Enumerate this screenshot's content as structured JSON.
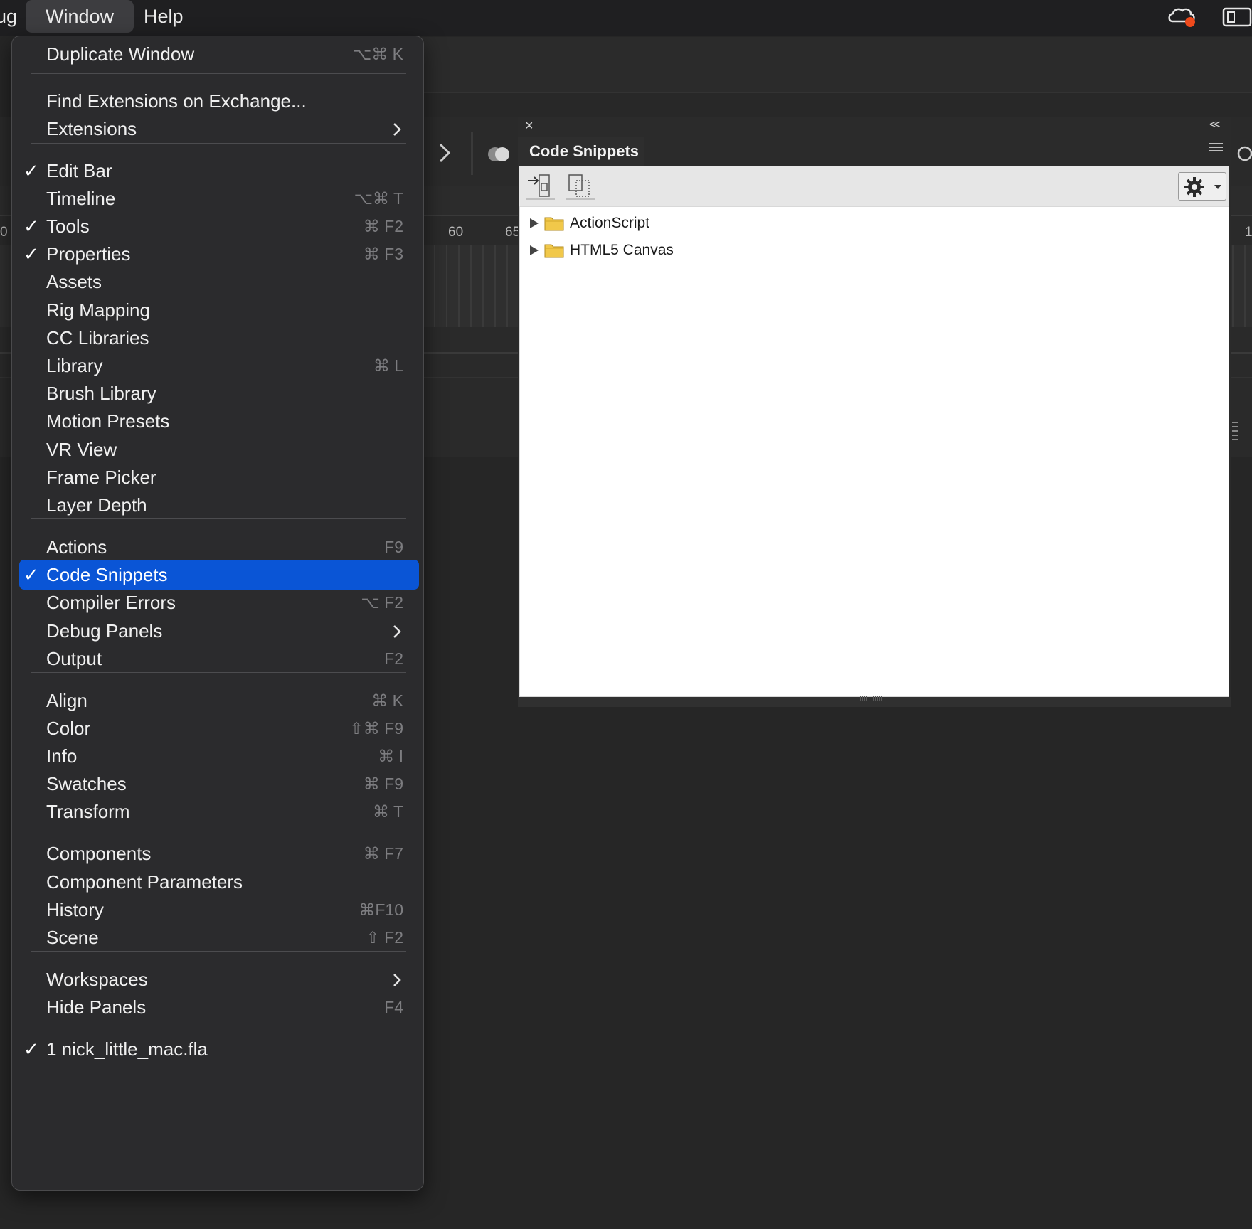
{
  "menubar": {
    "partial_item": "ug",
    "window_label": "Window",
    "help_label": "Help",
    "icons": [
      "creative-cloud-icon",
      "display-mirroring-icon"
    ]
  },
  "timeline": {
    "ticks": [
      "0",
      "60",
      "65",
      "1"
    ]
  },
  "panel": {
    "title": "Code Snippets",
    "close_glyph": "×",
    "collapse_glyph": "<<",
    "toolbar": {
      "icons": [
        "add-to-current-frame-icon",
        "copy-to-clipboard-icon",
        "gear-icon"
      ]
    },
    "tree": [
      {
        "label": "ActionScript",
        "icon": "folder-icon"
      },
      {
        "label": "HTML5 Canvas",
        "icon": "folder-icon"
      }
    ]
  },
  "menu": {
    "items": [
      {
        "label": "Duplicate Window",
        "shortcut": "⌥⌘ K",
        "checked": false
      },
      {
        "label": "Find Extensions on Exchange...",
        "shortcut": "",
        "checked": false
      },
      {
        "label": "Extensions",
        "shortcut": "",
        "checked": false,
        "submenu": true
      },
      {
        "label": "Edit Bar",
        "shortcut": "",
        "checked": true
      },
      {
        "label": "Timeline",
        "shortcut": "⌥⌘ T",
        "checked": false
      },
      {
        "label": "Tools",
        "shortcut": "⌘ F2",
        "checked": true
      },
      {
        "label": "Properties",
        "shortcut": "⌘ F3",
        "checked": true
      },
      {
        "label": "Assets",
        "shortcut": "",
        "checked": false
      },
      {
        "label": "Rig Mapping",
        "shortcut": "",
        "checked": false
      },
      {
        "label": "CC Libraries",
        "shortcut": "",
        "checked": false
      },
      {
        "label": "Library",
        "shortcut": "⌘ L",
        "checked": false
      },
      {
        "label": "Brush Library",
        "shortcut": "",
        "checked": false
      },
      {
        "label": "Motion Presets",
        "shortcut": "",
        "checked": false
      },
      {
        "label": "VR View",
        "shortcut": "",
        "checked": false
      },
      {
        "label": "Frame Picker",
        "shortcut": "",
        "checked": false
      },
      {
        "label": "Layer Depth",
        "shortcut": "",
        "checked": false
      },
      {
        "label": "Actions",
        "shortcut": "F9",
        "checked": false
      },
      {
        "label": "Code Snippets",
        "shortcut": "",
        "checked": true,
        "highlighted": true
      },
      {
        "label": "Compiler Errors",
        "shortcut": "⌥ F2",
        "checked": false
      },
      {
        "label": "Debug Panels",
        "shortcut": "",
        "checked": false,
        "submenu": true
      },
      {
        "label": "Output",
        "shortcut": "F2",
        "checked": false
      },
      {
        "label": "Align",
        "shortcut": "⌘ K",
        "checked": false
      },
      {
        "label": "Color",
        "shortcut": "⇧⌘ F9",
        "checked": false
      },
      {
        "label": "Info",
        "shortcut": "⌘ I",
        "checked": false
      },
      {
        "label": "Swatches",
        "shortcut": "⌘ F9",
        "checked": false
      },
      {
        "label": "Transform",
        "shortcut": "⌘ T",
        "checked": false
      },
      {
        "label": "Components",
        "shortcut": "⌘ F7",
        "checked": false
      },
      {
        "label": "Component Parameters",
        "shortcut": "",
        "checked": false
      },
      {
        "label": "History",
        "shortcut": "⌘F10",
        "checked": false
      },
      {
        "label": "Scene",
        "shortcut": "⇧ F2",
        "checked": false
      },
      {
        "label": "Workspaces",
        "shortcut": "",
        "checked": false,
        "submenu": true
      },
      {
        "label": "Hide Panels",
        "shortcut": "F4",
        "checked": false
      },
      {
        "label": "1 nick_little_mac.fla",
        "shortcut": "",
        "checked": true
      }
    ],
    "checkmark_glyph": "✓",
    "highlight_color": "#0a55d6"
  }
}
